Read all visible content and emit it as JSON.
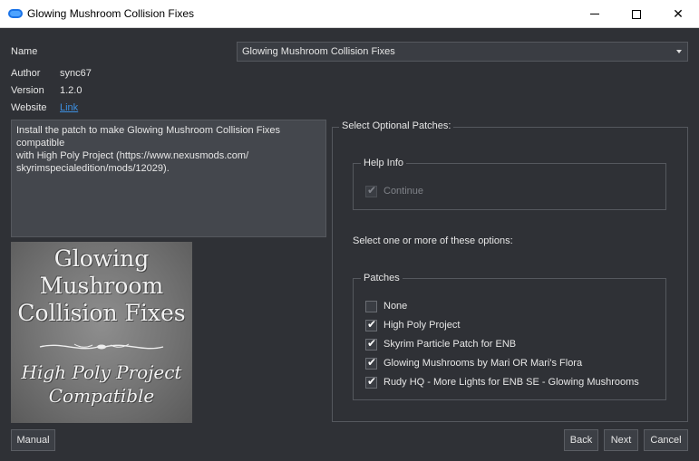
{
  "window": {
    "title": "Glowing Mushroom Collision Fixes",
    "minimize": "minimize",
    "maximize": "maximize",
    "close": "✕"
  },
  "info": {
    "name_label": "Name",
    "name_value": "Glowing Mushroom Collision Fixes",
    "author_label": "Author",
    "author_value": "sync67",
    "version_label": "Version",
    "version_value": "1.2.0",
    "website_label": "Website",
    "website_link": "Link"
  },
  "description": "Install the patch to make Glowing Mushroom Collision Fixes compatible\nwith High Poly Project (https://www.nexusmods.com/\nskyrimspecialedition/mods/12029).",
  "image": {
    "lines": [
      "Glowing",
      "Mushroom",
      "Collision Fixes",
      "High Poly Project",
      "Compatible"
    ]
  },
  "patches_panel": {
    "title": "Select Optional Patches:",
    "help_group": "Help Info",
    "help_option": {
      "label": "Continue",
      "checked": true,
      "disabled": true
    },
    "prompt": "Select one or more of these options:",
    "patches_group": "Patches",
    "options": [
      {
        "label": "None",
        "checked": false
      },
      {
        "label": "High Poly Project",
        "checked": true
      },
      {
        "label": "Skyrim Particle Patch for ENB",
        "checked": true
      },
      {
        "label": "Glowing Mushrooms by Mari OR Mari's Flora",
        "checked": true
      },
      {
        "label": "Rudy HQ - More Lights for ENB SE - Glowing Mushrooms",
        "checked": true
      }
    ]
  },
  "buttons": {
    "manual": "Manual",
    "back": "Back",
    "next": "Next",
    "cancel": "Cancel"
  },
  "colors": {
    "background": "#2f3136",
    "link": "#3d8fe0",
    "text": "#e6e6e6"
  }
}
